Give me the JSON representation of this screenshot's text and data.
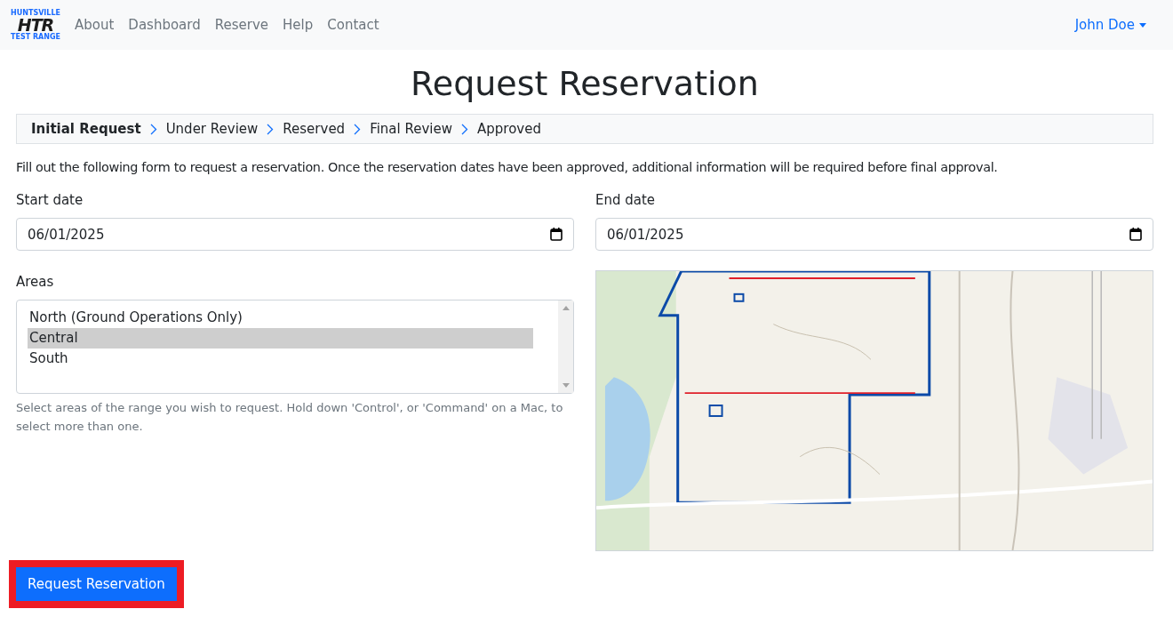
{
  "navbar": {
    "logo": {
      "top": "HUNTSVILLE",
      "middle": "HTR",
      "bottom": "TEST RANGE"
    },
    "links": [
      "About",
      "Dashboard",
      "Reserve",
      "Help",
      "Contact"
    ],
    "user": "John Doe"
  },
  "title": "Request Reservation",
  "steps": [
    {
      "label": "Initial Request",
      "selected": true
    },
    {
      "label": "Under Review",
      "selected": false
    },
    {
      "label": "Reserved",
      "selected": false
    },
    {
      "label": "Final Review",
      "selected": false
    },
    {
      "label": "Approved",
      "selected": false
    }
  ],
  "intro": "Fill out the following form to request a reservation. Once the reservation dates have been approved, additional information will be required before final approval.",
  "start_date": {
    "label": "Start date",
    "value": "06/01/2025"
  },
  "end_date": {
    "label": "End date",
    "value": "06/01/2025"
  },
  "areas": {
    "label": "Areas",
    "options": [
      {
        "label": "North (Ground Operations Only)",
        "selected": false
      },
      {
        "label": "Central",
        "selected": true
      },
      {
        "label": "South",
        "selected": false
      }
    ],
    "help": "Select areas of the range you wish to request. Hold down 'Control', or 'Command' on a Mac, to select more than one."
  },
  "submit": {
    "label": "Request Reservation",
    "highlighted": true
  }
}
